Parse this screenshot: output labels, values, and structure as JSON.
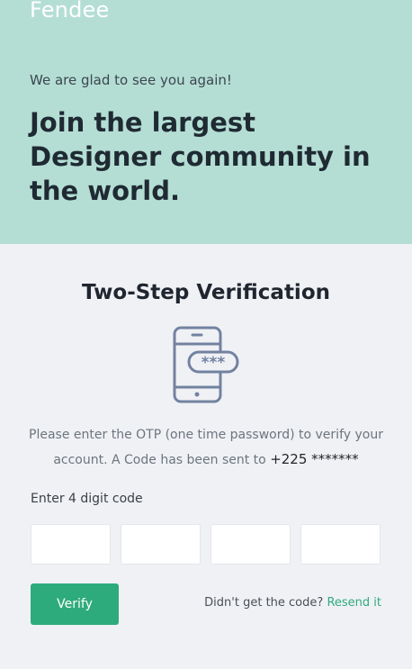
{
  "hero": {
    "brand": "Fendee",
    "welcome": "We are glad to see you again!",
    "headline": "Join the largest Designer community in the world."
  },
  "verification": {
    "title": "Two-Step Verification",
    "desc_before": "Please enter the OTP (one time password) to verify your account. A Code has been sent to ",
    "phone": "+225 *******",
    "code_label": "Enter 4 digit code",
    "digits": [
      "",
      "",
      "",
      ""
    ],
    "verify_label": "Verify",
    "resend_prompt": "Didn't get the code?",
    "resend_label": "Resend it"
  },
  "icons": {
    "illustration": "phone-password-icon"
  },
  "colors": {
    "hero_bg": "#b4ded4",
    "accent": "#2eab7c",
    "page_bg": "#f0f1f5"
  }
}
